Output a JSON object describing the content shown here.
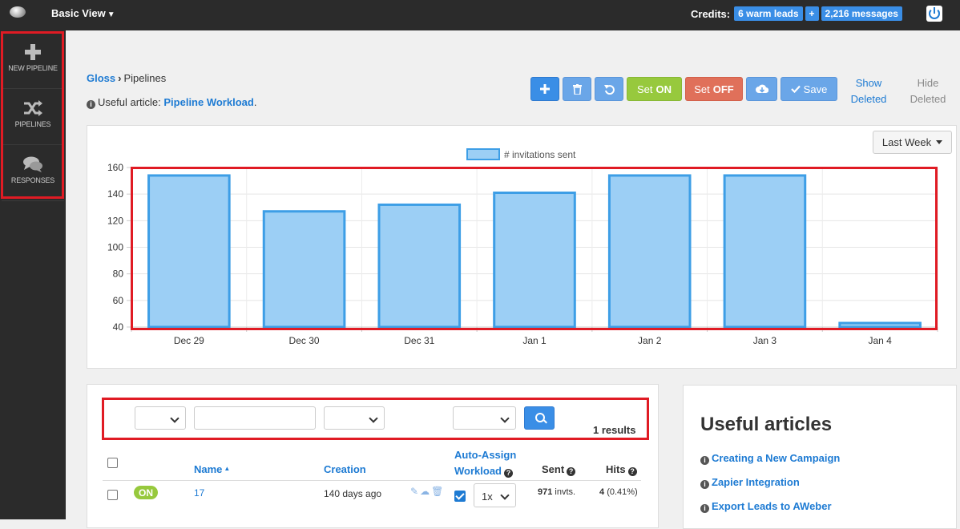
{
  "topbar": {
    "view_label": "Basic View",
    "credits_label": "Credits:",
    "warm_leads": "6 warm leads",
    "plus": "+",
    "messages": "2,216 messages"
  },
  "sidebar": {
    "items": [
      {
        "label": "NEW PIPELINE",
        "icon": "plus-icon"
      },
      {
        "label": "PIPELINES",
        "icon": "shuffle-icon"
      },
      {
        "label": "RESPONSES",
        "icon": "comments-icon"
      }
    ]
  },
  "breadcrumb": {
    "root": "Gloss",
    "current": "Pipelines"
  },
  "useful": {
    "prefix": "Useful article:",
    "link": "Pipeline Workload",
    "suffix": "."
  },
  "toolbar": {
    "set_on_prefix": "Set",
    "set_on_value": "ON",
    "set_off_prefix": "Set",
    "set_off_value": "OFF",
    "save": "Save",
    "show_deleted_1": "Show",
    "show_deleted_2": "Deleted",
    "hide_deleted_1": "Hide",
    "hide_deleted_2": "Deleted"
  },
  "period_select": "Last Week",
  "chart_data": {
    "type": "bar",
    "categories": [
      "Dec 29",
      "Dec 30",
      "Dec 31",
      "Jan 1",
      "Jan 2",
      "Jan 3",
      "Jan 4"
    ],
    "series": [
      {
        "name": "# invitations sent",
        "values": [
          154,
          127,
          132,
          141,
          154,
          154,
          43
        ]
      }
    ],
    "ylim": [
      40,
      160
    ],
    "yticks": [
      40,
      60,
      80,
      100,
      120,
      140,
      160
    ],
    "grid": true,
    "legend": "top-center",
    "colors": {
      "fill": "#9ccff5",
      "stroke": "#3d9ee6"
    }
  },
  "table": {
    "results": "1 results",
    "headers": {
      "name": "Name",
      "creation": "Creation",
      "auto_assign_1": "Auto-Assign",
      "auto_assign_2": "Workload",
      "sent": "Sent",
      "hits": "Hits"
    },
    "rows": [
      {
        "status": "ON",
        "name": "17",
        "creation": "140 days ago",
        "workload": "1x",
        "sent_num": "971",
        "sent_unit": "invts.",
        "hits_num": "4",
        "hits_pct": "(0.41%)"
      }
    ]
  },
  "articles": {
    "title": "Useful articles",
    "links": [
      "Creating a New Campaign",
      "Zapier Integration",
      "Export Leads to AWeber"
    ]
  }
}
